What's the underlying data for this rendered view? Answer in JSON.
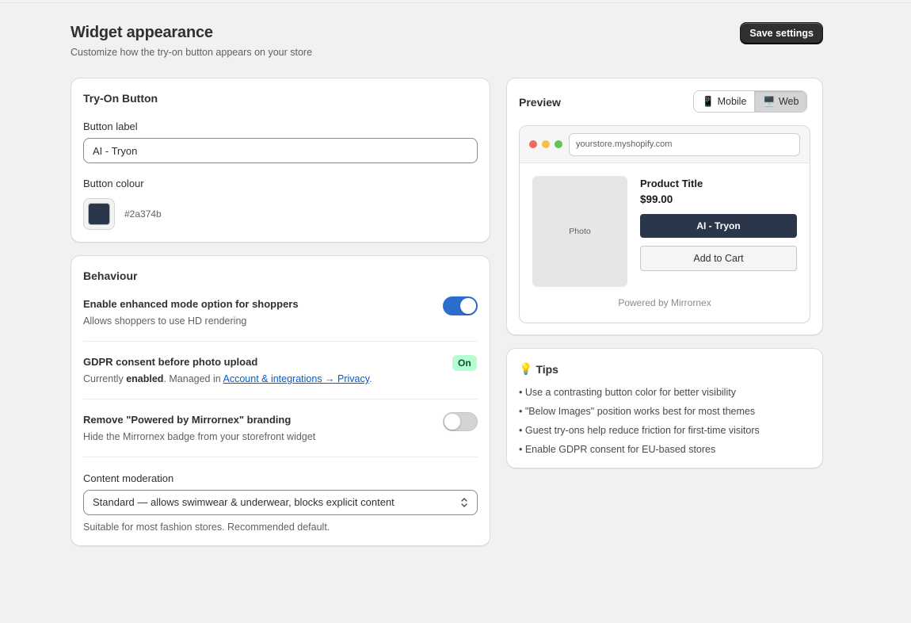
{
  "header": {
    "title": "Widget appearance",
    "subtitle": "Customize how the try-on button appears on your store",
    "save_label": "Save settings"
  },
  "tryon": {
    "title": "Try-On Button",
    "label_field_label": "Button label",
    "label_value": "AI - Tryon",
    "colour_field_label": "Button colour",
    "colour_hex": "#2a374b"
  },
  "behaviour": {
    "title": "Behaviour",
    "enhanced": {
      "title": "Enable enhanced mode option for shoppers",
      "desc": "Allows shoppers to use HD rendering",
      "enabled": true
    },
    "gdpr": {
      "title": "GDPR consent before photo upload",
      "desc_prefix": "Currently ",
      "desc_state": "enabled",
      "desc_mid": ". Managed in ",
      "link": "Account & integrations → Privacy",
      "desc_suffix": ".",
      "badge": "On"
    },
    "branding": {
      "title": "Remove \"Powered by Mirrornex\" branding",
      "desc": "Hide the Mirrornex badge from your storefront widget",
      "enabled": false
    },
    "moderation": {
      "label": "Content moderation",
      "selected": "Standard — allows swimwear & underwear, blocks explicit content",
      "help": "Suitable for most fashion stores. Recommended default."
    }
  },
  "preview": {
    "title": "Preview",
    "modes": [
      {
        "icon": "📱",
        "label": "Mobile",
        "active": false
      },
      {
        "icon": "🖥️",
        "label": "Web",
        "active": true
      }
    ],
    "url": "yourstore.myshopify.com",
    "photo_label": "Photo",
    "product_title": "Product Title",
    "price": "$99.00",
    "tryon_label": "AI - Tryon",
    "cart_label": "Add to Cart",
    "powered_by": "Powered by Mirrornex"
  },
  "tips": {
    "icon": "💡",
    "title": "Tips",
    "items": [
      "• Use a contrasting button color for better visibility",
      "• \"Below Images\" position works best for most themes",
      "• Guest try-ons help reduce friction for first-time visitors",
      "• Enable GDPR consent for EU-based stores"
    ]
  },
  "colors": {
    "button": "#2a374b",
    "dot_red": "#ed6a5e",
    "dot_yellow": "#f5bf4f",
    "dot_green": "#61c554"
  }
}
